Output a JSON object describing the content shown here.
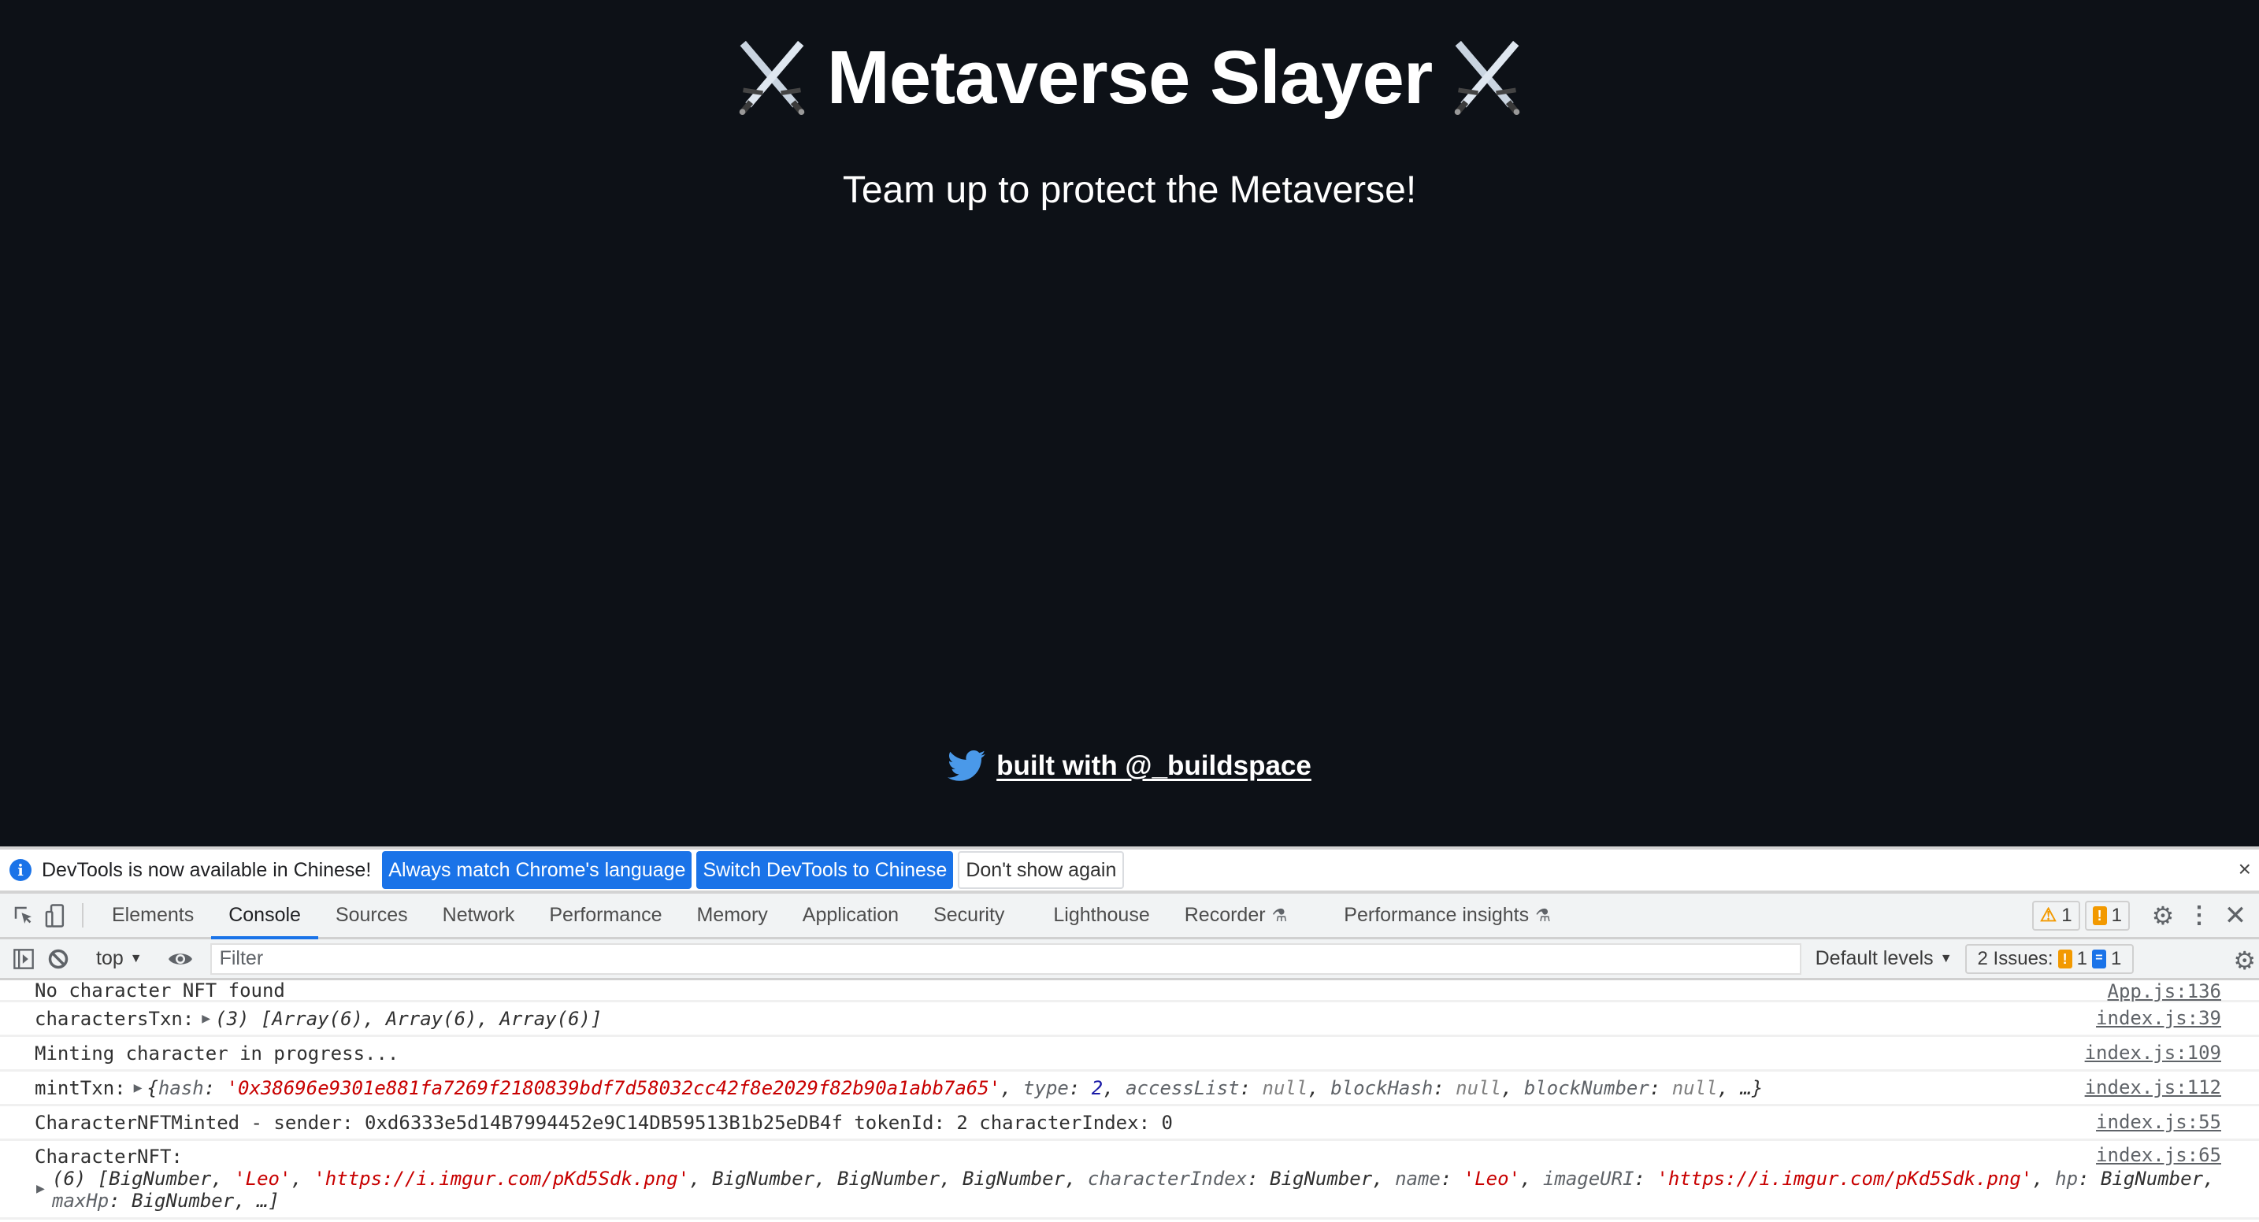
{
  "app": {
    "title": "Metaverse Slayer",
    "title_emoji": "crossed-swords",
    "subtitle": "Team up to protect the Metaverse!",
    "footer_link": "built with @_buildspace",
    "colors": {
      "background": "#0d1117",
      "twitter": "#4a99e9"
    }
  },
  "devtools": {
    "infobar": {
      "message": "DevTools is now available in Chinese!",
      "btn_match": "Always match Chrome's language",
      "btn_switch": "Switch DevTools to Chinese",
      "btn_dismiss": "Don't show again",
      "close": "×"
    },
    "tabs": [
      {
        "label": "Elements"
      },
      {
        "label": "Console",
        "active": true
      },
      {
        "label": "Sources"
      },
      {
        "label": "Network"
      },
      {
        "label": "Performance"
      },
      {
        "label": "Memory"
      },
      {
        "label": "Application"
      },
      {
        "label": "Security"
      },
      {
        "label": "Lighthouse"
      },
      {
        "label": "Recorder"
      },
      {
        "label": "Performance insights"
      }
    ],
    "warnings_count": "1",
    "errors_count": "1",
    "toolbar": {
      "context": "top",
      "filter_placeholder": "Filter",
      "levels": "Default levels",
      "issues_label": "2 Issues:",
      "issues_warn": "1",
      "issues_info": "1"
    },
    "console": [
      {
        "text": "No character NFT found",
        "source": "App.js:136"
      },
      {
        "prefix": "charactersTxn:",
        "value": "(3) [Array(6), Array(6), Array(6)]",
        "source": "index.js:39"
      },
      {
        "text": "Minting character in progress...",
        "source": "index.js:109"
      },
      {
        "prefix": "mintTxn:",
        "hash_key": "hash",
        "hash_value": "'0x38696e9301e881fa7269f2180839bdf7d58032cc42f8e2029f82b90a1abb7a65'",
        "type_key": "type",
        "type_value": "2",
        "access_key": "accessList",
        "blockhash_key": "blockHash",
        "blocknum_key": "blockNumber",
        "null": "null",
        "tail": "…}",
        "source": "index.js:112"
      },
      {
        "text": "CharacterNFTMinted - sender: 0xd6333e5d14B7994452e9C14DB59513B1b25eDB4f tokenId: 2 characterIndex: 0",
        "source": "index.js:55"
      },
      {
        "prefix": "CharacterNFT:",
        "line1_start": "(6) [BigNumber, ",
        "name_str": "'Leo'",
        "url_str": "'https://i.imgur.com/pKd5Sdk.png'",
        "mid": ", BigNumber, BigNumber, BigNumber, ",
        "ci_key": "characterIndex",
        "name_key": "name",
        "image_key": "imageURI",
        "hp_key": "hp",
        "maxhp_key": "maxHp",
        "bignumber": "BigNumber",
        "tail": "…]",
        "source": "index.js:65"
      }
    ]
  }
}
